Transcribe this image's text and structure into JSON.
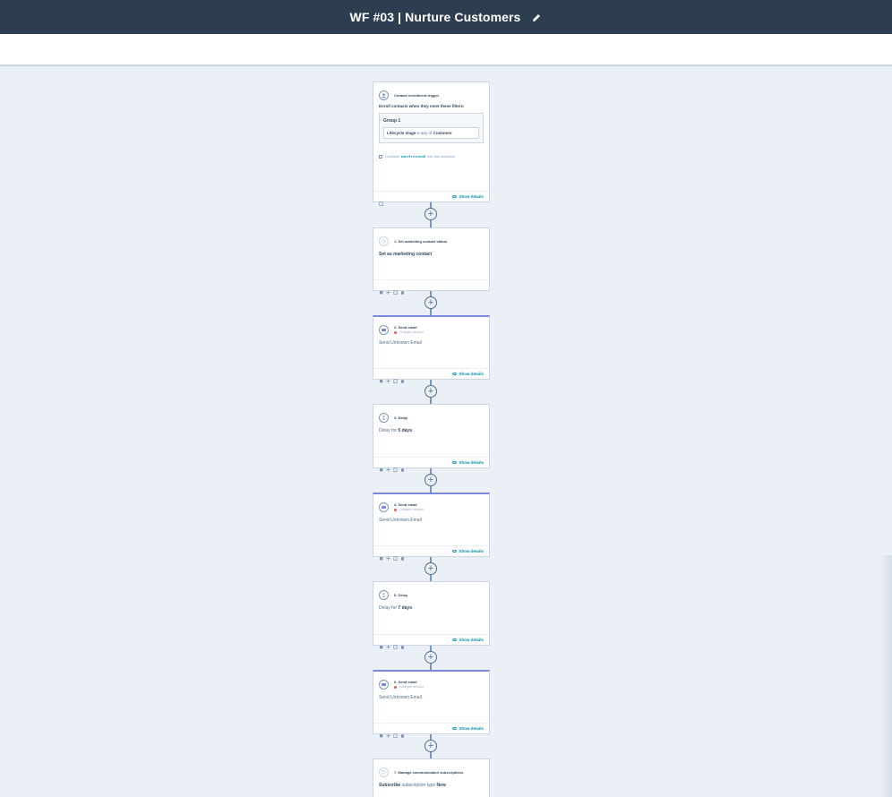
{
  "header": {
    "title": "WF #03 | Nurture Customers",
    "edit_icon": "pencil-icon"
  },
  "trigger": {
    "title": "Contact enrollment trigger",
    "enroll_text": "Enroll contacts when they meet these filters:",
    "group_name": "Group 1",
    "filter_property": "Lifecycle stage",
    "filter_operator": "is any of",
    "filter_value": "Customer",
    "reenroll_prefix": "Contacts",
    "reenroll_bold": "won't re-enroll",
    "reenroll_suffix": "into this workflow.",
    "show_details": "Show details"
  },
  "steps": [
    {
      "title": "1. Set marketing contact status",
      "body": "Set as marketing contact"
    },
    {
      "title": "2. Send email",
      "changes": "Changes needed",
      "body": "Send Unknown Email",
      "show_details": "Show details"
    },
    {
      "title": "3. Delay",
      "body_prefix": "Delay for",
      "body_bold": "5 days",
      "body_suffix": ".",
      "show_details": "Show details"
    },
    {
      "title": "4. Send email",
      "changes": "Changes needed",
      "body": "Send Unknown Email",
      "show_details": "Show details"
    },
    {
      "title": "5. Delay",
      "body_prefix": "Delay for",
      "body_bold": "7 days",
      "body_suffix": ".",
      "show_details": "Show details"
    },
    {
      "title": "6. Send email",
      "changes": "Changes needed",
      "body": "Send Unknown Email",
      "show_details": "Show details"
    },
    {
      "title": "7. Manage communication subscriptions",
      "body_bold": "Subscribe",
      "body_mid": "subscription type",
      "body_bold2": "New"
    }
  ],
  "add_action_symbol": "+"
}
